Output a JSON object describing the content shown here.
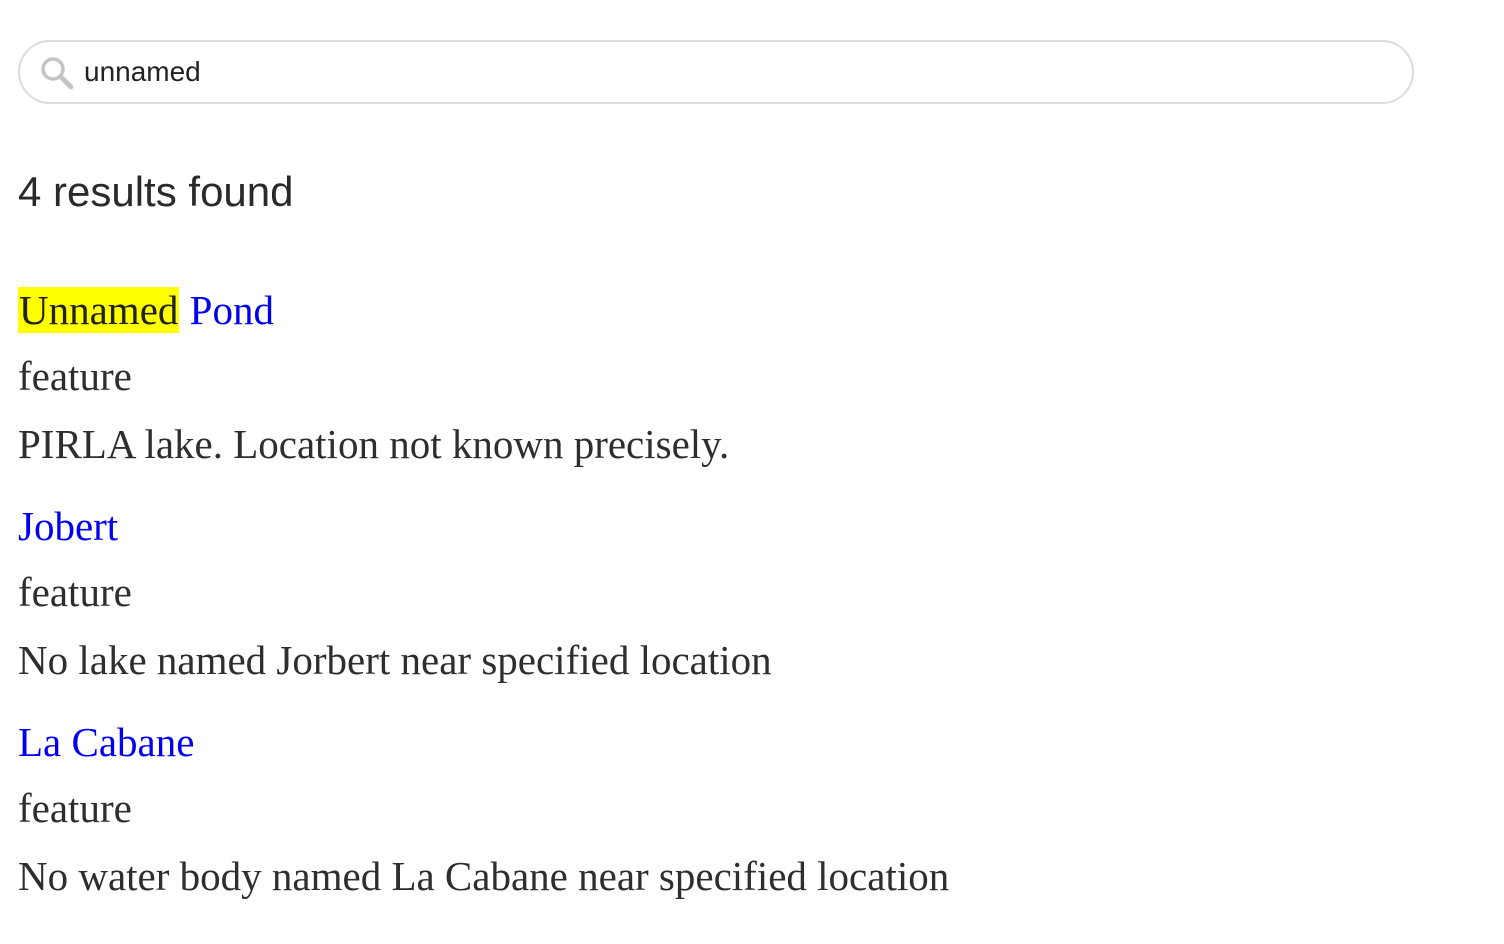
{
  "search": {
    "value": "unnamed",
    "icon": "magnifier"
  },
  "results_summary": "4 results found",
  "colors": {
    "link": "#0000ee",
    "highlight": "#ffff00",
    "text": "#2e2e2e",
    "border": "#dcdcdc"
  },
  "results": [
    {
      "title_highlight": "Unnamed",
      "title_rest": " Pond",
      "type": "feature",
      "description": "PIRLA lake. Location not known precisely."
    },
    {
      "title_highlight": "",
      "title_rest": "Jobert",
      "type": "feature",
      "description": "No lake named Jorbert near specified location"
    },
    {
      "title_highlight": "",
      "title_rest": "La Cabane",
      "type": "feature",
      "description": "No water body named La Cabane near specified location"
    }
  ]
}
